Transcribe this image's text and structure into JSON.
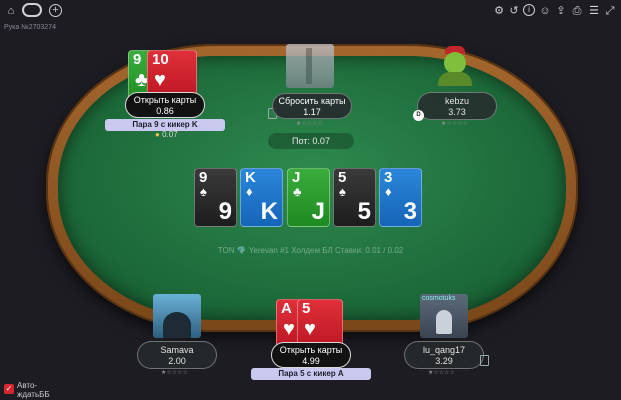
{
  "hand_number": "Рука №2703274",
  "pot": "Пот: 0.07",
  "table_info": "TON  💎  Yerevan #1 Холдем БЛ Ставки: 0.01 / 0.02",
  "dealer_label": "D",
  "board": [
    {
      "rank": "9",
      "suit": "♠",
      "color": "black"
    },
    {
      "rank": "K",
      "suit": "♦",
      "color": "blue"
    },
    {
      "rank": "J",
      "suit": "♣",
      "color": "green"
    },
    {
      "rank": "5",
      "suit": "♠",
      "color": "black"
    },
    {
      "rank": "3",
      "suit": "♦",
      "color": "blue"
    }
  ],
  "seats": {
    "top_left": {
      "action": "Открыть карты",
      "stack": "0.86",
      "hand_label": "Пара 9 с кикер K",
      "extra": "0.07",
      "cards": [
        {
          "rank": "9",
          "suit": "♣"
        },
        {
          "rank": "10",
          "suit": "♥"
        }
      ]
    },
    "top_center": {
      "action": "Сбросить карты",
      "stack": "1.17",
      "stars": "★☆☆☆☆"
    },
    "top_right": {
      "name": "kebzu",
      "stack": "3.73",
      "stars": "★☆☆☆☆"
    },
    "bottom_left": {
      "name": "Samava",
      "stack": "2.00",
      "stars": "★☆☆☆☆"
    },
    "bottom_center": {
      "action": "Открыть карты",
      "stack": "4.99",
      "hand_label": "Пара 5 с кикер A",
      "cards": [
        {
          "rank": "A",
          "suit": "♥"
        },
        {
          "rank": "5",
          "suit": "♥"
        }
      ]
    },
    "bottom_right": {
      "name": "lu_qang17",
      "stack": "3.29",
      "stars": "★☆☆☆☆",
      "avatar_text": "cosmotuks"
    }
  },
  "auto_bb": {
    "label_line1": "Авто-",
    "label_line2": "ждатьББ",
    "checked": "✓"
  },
  "icons": {
    "topbar_left": [
      "home-icon",
      "table-pill-icon",
      "add-table-icon"
    ],
    "topbar_right": [
      "game-type-icon",
      "history-icon",
      "info-icon",
      "palette-icon",
      "share-icon",
      "rebuy-icon",
      "menu-icon",
      "fullscreen-icon"
    ]
  }
}
